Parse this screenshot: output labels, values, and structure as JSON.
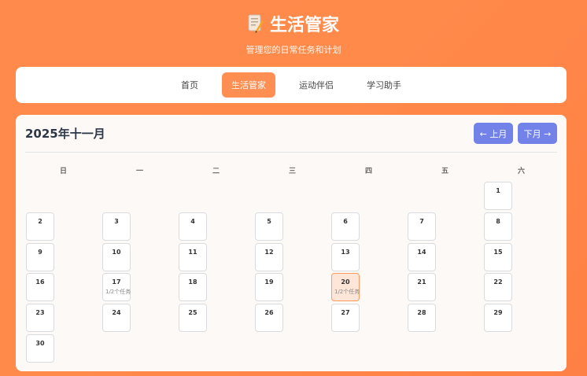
{
  "app": {
    "title": "生活管家",
    "subtitle": "管理您的日常任务和计划",
    "logo_icon": "notepad-pencil-icon"
  },
  "nav": {
    "tabs": [
      {
        "label": "首页",
        "active": false
      },
      {
        "label": "生活管家",
        "active": true
      },
      {
        "label": "运动伴侣",
        "active": false
      },
      {
        "label": "学习助手",
        "active": false
      }
    ]
  },
  "calendar": {
    "month_title": "2025年十一月",
    "prev_label": "← 上月",
    "next_label": "下月 →",
    "weekdays": [
      "日",
      "一",
      "二",
      "三",
      "四",
      "五",
      "六"
    ],
    "first_weekday_index": 6,
    "days": [
      {
        "day": "1"
      },
      {
        "day": "2"
      },
      {
        "day": "3"
      },
      {
        "day": "4"
      },
      {
        "day": "5"
      },
      {
        "day": "6"
      },
      {
        "day": "7"
      },
      {
        "day": "8"
      },
      {
        "day": "9"
      },
      {
        "day": "10"
      },
      {
        "day": "11"
      },
      {
        "day": "12"
      },
      {
        "day": "13"
      },
      {
        "day": "14"
      },
      {
        "day": "15"
      },
      {
        "day": "16"
      },
      {
        "day": "17",
        "task": "1/2个任务"
      },
      {
        "day": "18"
      },
      {
        "day": "19"
      },
      {
        "day": "20",
        "task": "1/2个任务",
        "today": true
      },
      {
        "day": "21"
      },
      {
        "day": "22"
      },
      {
        "day": "23"
      },
      {
        "day": "24"
      },
      {
        "day": "25"
      },
      {
        "day": "26"
      },
      {
        "day": "27"
      },
      {
        "day": "28"
      },
      {
        "day": "29"
      },
      {
        "day": "30"
      }
    ]
  },
  "colors": {
    "accent": "#ff8e52",
    "button": "#7382e8",
    "background": "#ff8a4c"
  }
}
